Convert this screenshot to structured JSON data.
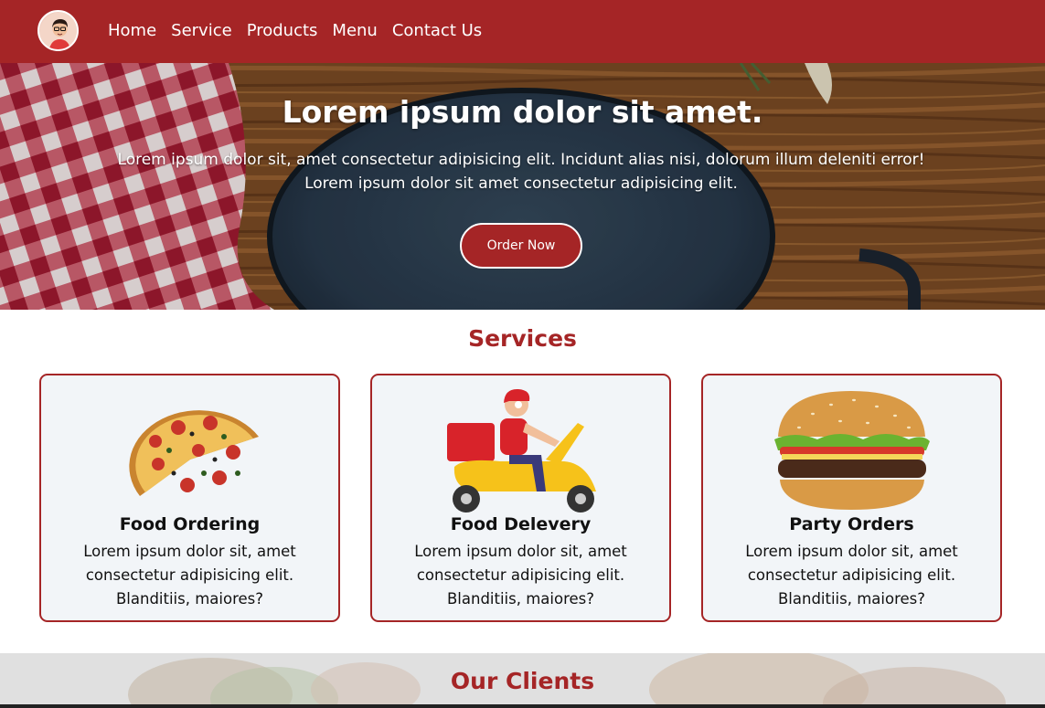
{
  "navbar": {
    "logo_icon": "avatar-logo",
    "links": [
      "Home",
      "Service",
      "Products",
      "Menu",
      "Contact Us"
    ],
    "color": "#a52526"
  },
  "hero": {
    "title": "Lorem ipsum dolor sit amet.",
    "subtitle_line1": "Lorem ipsum dolor sit, amet consectetur adipisicing elit. Incidunt alias nisi, dolorum illum deleniti error!",
    "subtitle_line2": "Lorem ipsum dolor sit amet consectetur adipisicing elit.",
    "button": "Order Now"
  },
  "services": {
    "title": "Services",
    "cards": [
      {
        "title": "Food Ordering",
        "text": "Lorem ipsum dolor sit, amet consectetur adipisicing elit. Blanditiis, maiores?",
        "icon": "pizza-image"
      },
      {
        "title": "Food Delevery",
        "text": "Lorem ipsum dolor sit, amet consectetur adipisicing elit. Blanditiis, maiores?",
        "icon": "delivery-scooter-image"
      },
      {
        "title": "Party Orders",
        "text": "Lorem ipsum dolor sit, amet consectetur adipisicing elit. Blanditiis, maiores?",
        "icon": "burger-image"
      }
    ]
  },
  "clients": {
    "title": "Our Clients"
  }
}
